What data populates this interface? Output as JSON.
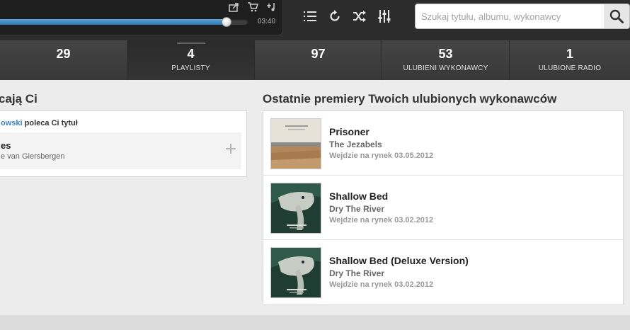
{
  "player": {
    "time": "03:40",
    "progress": 0.915,
    "icons": [
      "share-icon",
      "cart-icon",
      "add-to-playlist-icon"
    ],
    "controls": [
      "queue-list-icon",
      "repeat-icon",
      "shuffle-icon",
      "equalizer-icon"
    ]
  },
  "search": {
    "placeholder": "Szukaj tytułu, albumu, wykonawcy"
  },
  "stats": [
    {
      "number": "29",
      "label": ""
    },
    {
      "number": "4",
      "label": "PLAYLISTY"
    },
    {
      "number": "97",
      "label": ""
    },
    {
      "number": "53",
      "label": "ULUBIENI WYKONAWCY"
    },
    {
      "number": "1",
      "label": "ULUBIONE RADIO"
    }
  ],
  "left_section": {
    "title": "cają Ci",
    "recommender_name": "owski",
    "recommender_text": " poleca Ci tytuł",
    "item_title": "es",
    "item_artist": "e van Giersbergen",
    "add_icon": "plus-icon"
  },
  "right_section": {
    "title": "Ostatnie premiery Twoich ulubionych wykonawców",
    "releases": [
      {
        "title": "Prisoner",
        "artist": "The Jezabels",
        "date": "Wejdzie na rynek 03.05.2012"
      },
      {
        "title": "Shallow Bed",
        "artist": "Dry The River",
        "date": "Wejdzie na rynek 03.02.2012"
      },
      {
        "title": "Shallow Bed (Deluxe Version)",
        "artist": "Dry The River",
        "date": "Wejdzie na rynek 03.02.2012"
      }
    ]
  },
  "colors": {
    "accent": "#3b82c4",
    "progress": "#3a88c4",
    "dark_bar": "#2c2c2c"
  }
}
